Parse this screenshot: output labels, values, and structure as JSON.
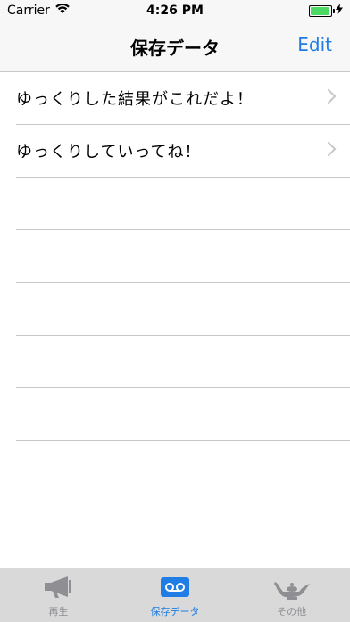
{
  "status": {
    "carrier": "Carrier",
    "time": "4:26 PM"
  },
  "nav": {
    "title": "保存データ",
    "edit_label": "Edit"
  },
  "list": {
    "items": [
      {
        "label": "ゆっくりした結果がこれだよ！"
      },
      {
        "label": "ゆっくりしていってね！"
      }
    ]
  },
  "tabs": [
    {
      "label": "再生",
      "icon": "megaphone-icon",
      "active": false
    },
    {
      "label": "保存データ",
      "icon": "voicemail-icon",
      "active": true
    },
    {
      "label": "その他",
      "icon": "lamp-icon",
      "active": false
    }
  ],
  "colors": {
    "accent": "#1f7de5",
    "inactive": "#8e8e93",
    "battery": "#4cd964"
  }
}
